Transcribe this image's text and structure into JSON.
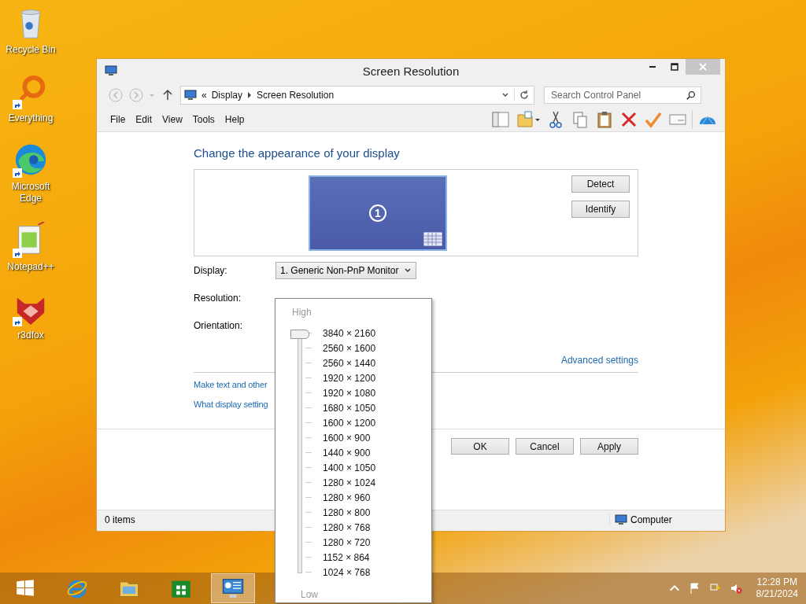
{
  "desktop_icons": [
    {
      "label": "Recycle Bin",
      "kind": "bin"
    },
    {
      "label": "Everything",
      "kind": "ring"
    },
    {
      "label": "Microsoft Edge",
      "kind": "edge"
    },
    {
      "label": "Notepad++",
      "kind": "notepad"
    },
    {
      "label": "r3dfox",
      "kind": "fox"
    }
  ],
  "window": {
    "title": "Screen Resolution",
    "address": {
      "crumbs": [
        "«",
        "Display",
        "Screen Resolution"
      ]
    },
    "search": {
      "placeholder": "Search Control Panel"
    },
    "menu": [
      "File",
      "Edit",
      "View",
      "Tools",
      "Help"
    ],
    "heading": "Change the appearance of your display",
    "monitor_label": "1",
    "preview_buttons": [
      "Detect",
      "Identify"
    ],
    "fields": [
      {
        "label": "Display:",
        "value": "1. Generic Non-PnP Monitor"
      },
      {
        "label": "Resolution:"
      },
      {
        "label": "Orientation:"
      }
    ],
    "advanced_link": "Advanced settings",
    "links": [
      "Make text and other",
      "What display setting"
    ],
    "buttons": [
      "OK",
      "Cancel",
      "Apply"
    ],
    "status_bar": {
      "items": "0 items",
      "location": "Computer"
    }
  },
  "resolution_popup": {
    "high": "High",
    "low": "Low",
    "level": 1,
    "resolutions": [
      "3840 × 2160",
      "2560 × 1600",
      "2560 × 1440",
      "1920 × 1200",
      "1920 × 1080",
      "1680 × 1050",
      "1600 × 1200",
      "1600 × 900",
      "1440 × 900",
      "1400 × 1050",
      "1280 × 1024",
      "1280 × 960",
      "1280 × 800",
      "1280 × 768",
      "1280 × 720",
      "1152 × 864",
      "1024 × 768"
    ]
  },
  "taskbar": {
    "apps": [
      {
        "kind": "start",
        "active": false
      },
      {
        "kind": "ie",
        "active": false
      },
      {
        "kind": "explorer",
        "active": false
      },
      {
        "kind": "store",
        "active": false
      },
      {
        "kind": "control",
        "active": true
      }
    ],
    "time": "12:28 PM",
    "date": "8/21/2024"
  }
}
